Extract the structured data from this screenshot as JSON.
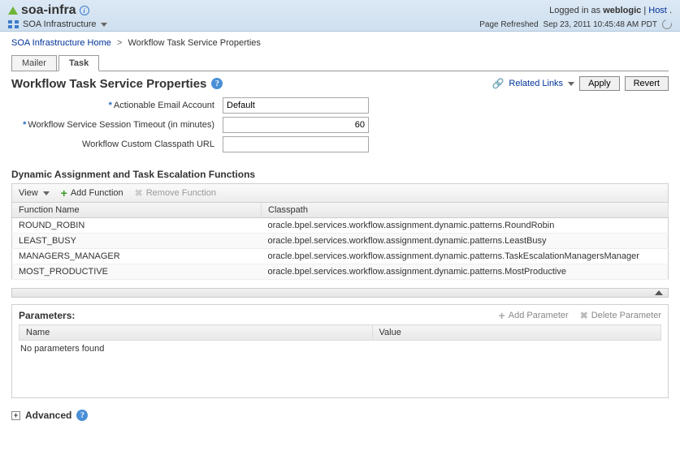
{
  "header": {
    "title": "soa-infra",
    "subtitle": "SOA Infrastructure",
    "logged_in_prefix": "Logged in as ",
    "user": "weblogic",
    "host_sep": "|",
    "host_label": "Host",
    "host_suffix": ".",
    "refreshed_prefix": "Page Refreshed ",
    "refreshed_ts": "Sep 23, 2011 10:45:48 AM PDT"
  },
  "breadcrumb": {
    "home": "SOA Infrastructure Home",
    "sep": ">",
    "current": "Workflow Task Service Properties"
  },
  "tabs": {
    "mailer": "Mailer",
    "task": "Task"
  },
  "page": {
    "title": "Workflow Task Service Properties",
    "related_links": "Related Links",
    "apply": "Apply",
    "revert": "Revert"
  },
  "form": {
    "email_label": "Actionable Email Account",
    "email_value": "Default",
    "timeout_label": "Workflow Service Session Timeout (in minutes)",
    "timeout_value": "60",
    "classpath_label": "Workflow Custom Classpath URL",
    "classpath_value": ""
  },
  "functions": {
    "section_title": "Dynamic Assignment and Task Escalation Functions",
    "view": "View",
    "add": "Add Function",
    "remove": "Remove Function",
    "col_name": "Function Name",
    "col_classpath": "Classpath",
    "rows": [
      {
        "name": "ROUND_ROBIN",
        "cp": "oracle.bpel.services.workflow.assignment.dynamic.patterns.RoundRobin"
      },
      {
        "name": "LEAST_BUSY",
        "cp": "oracle.bpel.services.workflow.assignment.dynamic.patterns.LeastBusy"
      },
      {
        "name": "MANAGERS_MANAGER",
        "cp": "oracle.bpel.services.workflow.assignment.dynamic.patterns.TaskEscalationManagersManager"
      },
      {
        "name": "MOST_PRODUCTIVE",
        "cp": "oracle.bpel.services.workflow.assignment.dynamic.patterns.MostProductive"
      }
    ]
  },
  "params": {
    "title": "Parameters:",
    "add": "Add Parameter",
    "delete": "Delete Parameter",
    "col_name": "Name",
    "col_value": "Value",
    "empty": "No parameters found"
  },
  "advanced": {
    "label": "Advanced",
    "expand_symbol": "+"
  }
}
